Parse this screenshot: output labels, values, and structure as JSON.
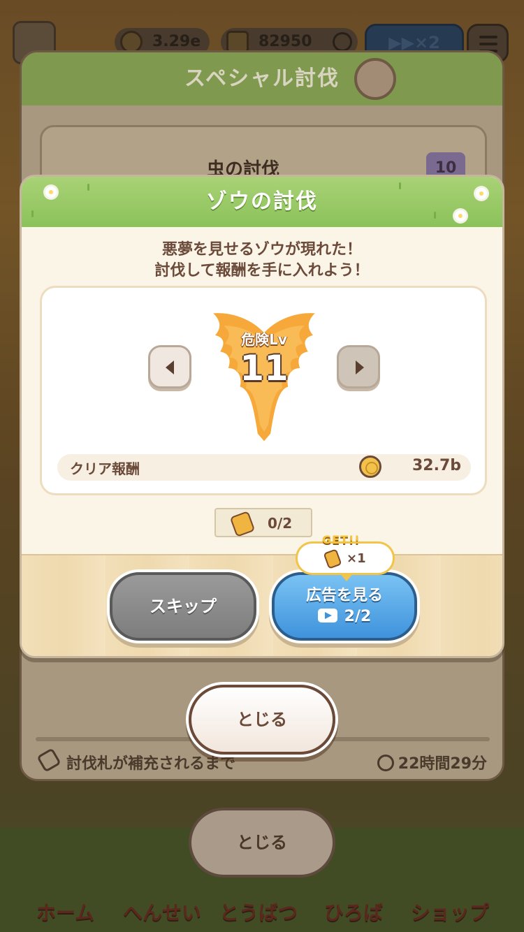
{
  "topbar": {
    "coins": "3.29e",
    "gems": "82950",
    "speed": "▶▶×2"
  },
  "bottom_nav": [
    {
      "label": "ホーム"
    },
    {
      "label": "へんせい"
    },
    {
      "label": "とうばつ"
    },
    {
      "label": "ひろば"
    },
    {
      "label": "ショップ"
    }
  ],
  "special_panel": {
    "title": "スペシャル討伐",
    "card_name": "虫の討伐",
    "card_level": "10",
    "refill_label": "討伐札が補充されるまで",
    "refill_time": "22時間29分",
    "close_label": "とじる"
  },
  "dialog": {
    "title": "ゾウの討伐",
    "description_line1": "悪夢を見せるゾウが現れた！",
    "description_line2": "討伐して報酬を手に入れよう！",
    "danger_label": "危険Lv",
    "danger_level": "11",
    "reward_label": "クリア報酬",
    "reward_value": "32.7b",
    "ticket_count": "0/2",
    "bonus_get": "GET!!",
    "bonus_amount": "×1",
    "skip_label": "スキップ",
    "ad_label": "広告を見る",
    "ad_count": "2/2",
    "close_label": "とじる"
  },
  "colors": {
    "header_green": "#8bc25a",
    "ad_button_blue": "#3f93dc",
    "skip_button_gray": "#7d7d7d",
    "badge_orange": "#f6a93a",
    "text_brown": "#6b4a3a"
  },
  "icons": [
    "avatar-icon",
    "coin-icon",
    "gem-icon",
    "info-icon",
    "menu-icon",
    "bulb-icon",
    "ticket-icon",
    "clock-icon",
    "video-icon",
    "arrow-left-icon",
    "arrow-right-icon"
  ]
}
